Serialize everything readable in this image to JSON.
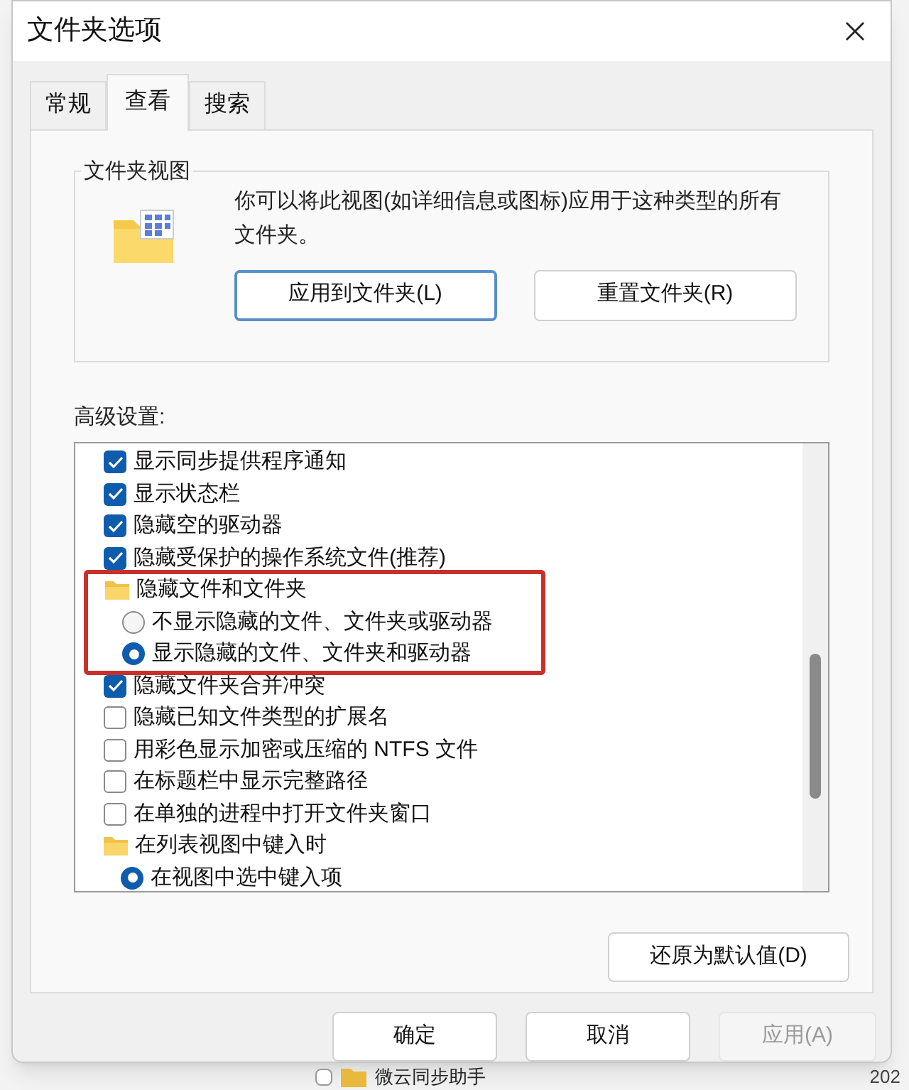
{
  "window": {
    "title": "文件夹选项"
  },
  "tabs": [
    {
      "label": "常规",
      "selected": false
    },
    {
      "label": "查看",
      "selected": true
    },
    {
      "label": "搜索",
      "selected": false
    }
  ],
  "folder_views": {
    "title": "文件夹视图",
    "description": "你可以将此视图(如详细信息或图标)应用于这种类型的所有文件夹。",
    "buttons": [
      {
        "label": "应用到文件夹(L)",
        "focused": true
      },
      {
        "label": "重置文件夹(R)",
        "focused": false
      }
    ]
  },
  "advanced": {
    "label": "高级设置:",
    "items": [
      {
        "kind": "checkbox",
        "label": "显示同步提供程序通知",
        "checked": true
      },
      {
        "kind": "checkbox",
        "label": "显示状态栏",
        "checked": true
      },
      {
        "kind": "checkbox",
        "label": "隐藏空的驱动器",
        "checked": true
      },
      {
        "kind": "checkbox",
        "label": "隐藏受保护的操作系统文件(推荐)",
        "checked": true
      },
      {
        "kind": "folder",
        "label": "隐藏文件和文件夹",
        "highlighted": true,
        "children": [
          {
            "kind": "radio",
            "label": "不显示隐藏的文件、文件夹或驱动器",
            "selected": false
          },
          {
            "kind": "radio",
            "label": "显示隐藏的文件、文件夹和驱动器",
            "selected": true
          }
        ]
      },
      {
        "kind": "checkbox",
        "label": "隐藏文件夹合并冲突",
        "checked": true
      },
      {
        "kind": "checkbox",
        "label": "隐藏已知文件类型的扩展名",
        "checked": false
      },
      {
        "kind": "checkbox",
        "label": "用彩色显示加密或压缩的 NTFS 文件",
        "checked": false
      },
      {
        "kind": "checkbox",
        "label": "在标题栏中显示完整路径",
        "checked": false
      },
      {
        "kind": "checkbox",
        "label": "在单独的进程中打开文件夹窗口",
        "checked": false
      },
      {
        "kind": "folder",
        "label": "在列表视图中键入时",
        "highlighted": false,
        "children": [
          {
            "kind": "radio",
            "label": "在视图中选中键入项",
            "selected": true
          }
        ]
      }
    ],
    "restore_button": "还原为默认值(D)"
  },
  "buttons": [
    {
      "label": "确定",
      "disabled": false
    },
    {
      "label": "取消",
      "disabled": false
    },
    {
      "label": "应用(A)",
      "disabled": true
    }
  ],
  "background_row": {
    "checked": false,
    "name": "微云同步助手",
    "date": "202"
  }
}
